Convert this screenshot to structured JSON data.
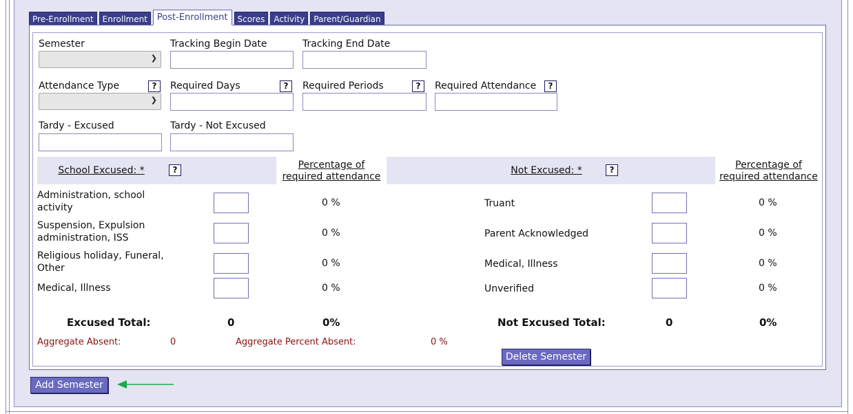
{
  "tabs": [
    {
      "label": "Pre-Enrollment"
    },
    {
      "label": "Enrollment"
    },
    {
      "label": "Post-Enrollment",
      "active": true
    },
    {
      "label": "Scores"
    },
    {
      "label": "Activity"
    },
    {
      "label": "Parent/Guardian"
    }
  ],
  "form": {
    "semester_label": "Semester",
    "semester_value": "",
    "tracking_begin_label": "Tracking Begin Date",
    "tracking_begin_value": "",
    "tracking_end_label": "Tracking End Date",
    "tracking_end_value": "",
    "attendance_type_label": "Attendance Type",
    "attendance_type_value": "",
    "required_days_label": "Required Days",
    "required_days_value": "",
    "required_periods_label": "Required Periods",
    "required_periods_value": "",
    "required_attendance_label": "Required Attendance",
    "required_attendance_value": "",
    "tardy_excused_label": "Tardy - Excused",
    "tardy_excused_value": "",
    "tardy_not_excused_label": "Tardy - Not Excused",
    "tardy_not_excused_value": "",
    "help_glyph": "?"
  },
  "table": {
    "excused_header": "School Excused: *",
    "not_excused_header": "Not Excused: *",
    "pct_header_line1": "Percentage of",
    "pct_header_line2": "required attendance",
    "excused_rows": [
      {
        "line1": "Administration, school",
        "line2": "activity",
        "count": "",
        "pct": "0 %"
      },
      {
        "line1": "Suspension, Expulsion",
        "line2": "administration, ISS",
        "count": "",
        "pct": "0 %"
      },
      {
        "line1": "Religious holiday, Funeral,",
        "line2": "Other",
        "count": "",
        "pct": "0 %"
      },
      {
        "line1": "Medical, Illness",
        "line2": "",
        "count": "",
        "pct": "0 %"
      }
    ],
    "not_excused_rows": [
      {
        "label": "Truant",
        "count": "",
        "pct": "0 %"
      },
      {
        "label": "Parent Acknowledged",
        "count": "",
        "pct": "0 %"
      },
      {
        "label": "Medical, Illness",
        "count": "",
        "pct": "0 %"
      },
      {
        "label": "Unverified",
        "count": "",
        "pct": "0 %"
      }
    ],
    "excused_total_label": "Excused Total:",
    "excused_total_value": "0",
    "excused_total_pct": "0%",
    "not_excused_total_label": "Not Excused Total:",
    "not_excused_total_value": "0",
    "not_excused_total_pct": "0%"
  },
  "aggregate": {
    "absent_label": "Aggregate Absent:",
    "absent_value": "0",
    "percent_label": "Aggregate Percent Absent:",
    "percent_value": "0 %"
  },
  "buttons": {
    "delete_semester": "Delete Semester",
    "add_semester": "Add Semester"
  },
  "colors": {
    "tab_bg": "#3a3d8a",
    "button_bg": "#6a6ac0",
    "panel_bg": "#e4e4f2",
    "aggregate_text": "#8a1010",
    "arrow": "#1aaa4a"
  }
}
